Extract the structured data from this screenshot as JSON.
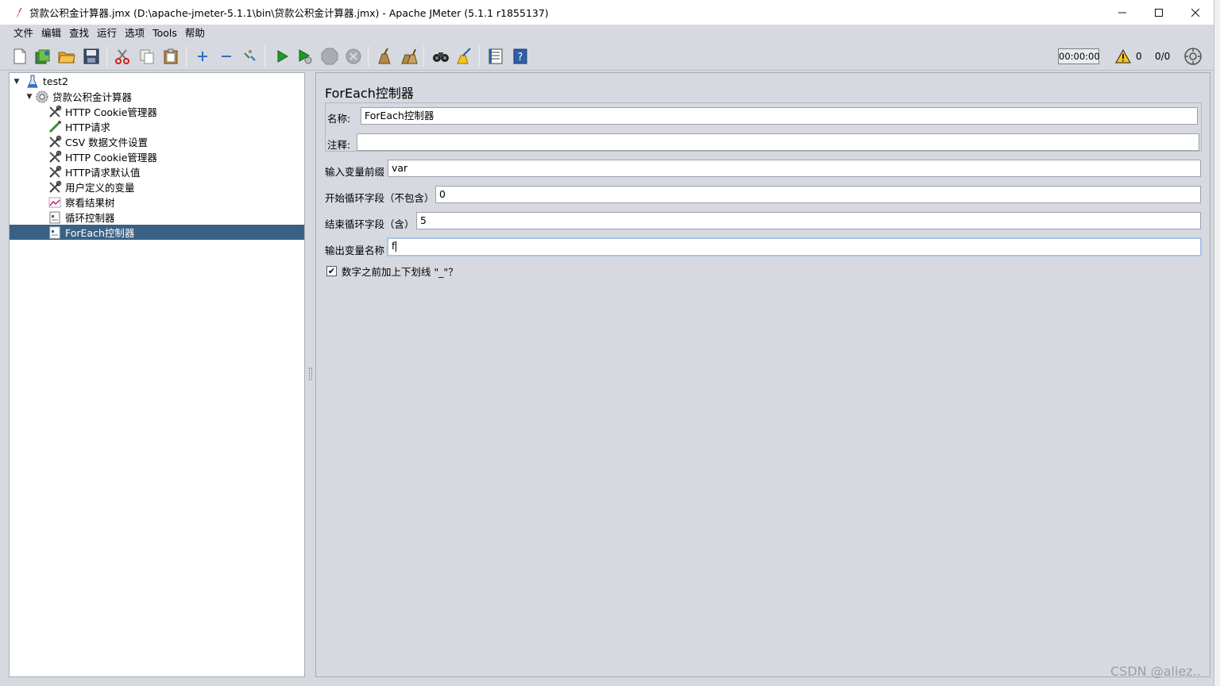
{
  "window": {
    "title": "贷款公积金计算器.jmx (D:\\apache-jmeter-5.1.1\\bin\\贷款公积金计算器.jmx) - Apache JMeter (5.1.1 r1855137)",
    "minimize": "—",
    "maximize": "☐",
    "close": "✕"
  },
  "menu": [
    "文件",
    "编辑",
    "查找",
    "运行",
    "选项",
    "Tools",
    "帮助"
  ],
  "toolbar": {
    "timer": "00:00:00",
    "warnings": "0",
    "threads": "0/0"
  },
  "tree": [
    {
      "label": "test2",
      "icon": "test-plan-icon",
      "toggle": "▼"
    },
    {
      "label": "贷款公积金计算器",
      "icon": "thread-group-icon",
      "toggle": "▼"
    },
    {
      "label": "HTTP Cookie管理器",
      "icon": "config-element-icon"
    },
    {
      "label": "HTTP请求",
      "icon": "sampler-icon"
    },
    {
      "label": "CSV 数据文件设置",
      "icon": "config-element-icon"
    },
    {
      "label": "HTTP Cookie管理器",
      "icon": "config-element-icon"
    },
    {
      "label": "HTTP请求默认值",
      "icon": "config-element-icon"
    },
    {
      "label": "用户定义的变量",
      "icon": "config-element-icon"
    },
    {
      "label": "察看结果树",
      "icon": "listener-icon"
    },
    {
      "label": "循环控制器",
      "icon": "controller-icon"
    },
    {
      "label": "ForEach控制器",
      "icon": "controller-icon",
      "selected": true
    }
  ],
  "panel": {
    "title": "ForEach控制器",
    "name_label": "名称:",
    "name_value": "ForEach控制器",
    "comment_label": "注释:",
    "comment_value": "",
    "input_prefix_label": "输入变量前缀",
    "input_prefix_value": "var",
    "start_label": "开始循环字段（不包含）",
    "start_value": "0",
    "end_label": "结束循环字段（含）",
    "end_value": "5",
    "output_label": "输出变量名称",
    "output_value": "f",
    "underscore_label": "数字之前加上下划线 \"_\"？",
    "underscore_checked": true
  },
  "watermark": "CSDN @aliez.."
}
